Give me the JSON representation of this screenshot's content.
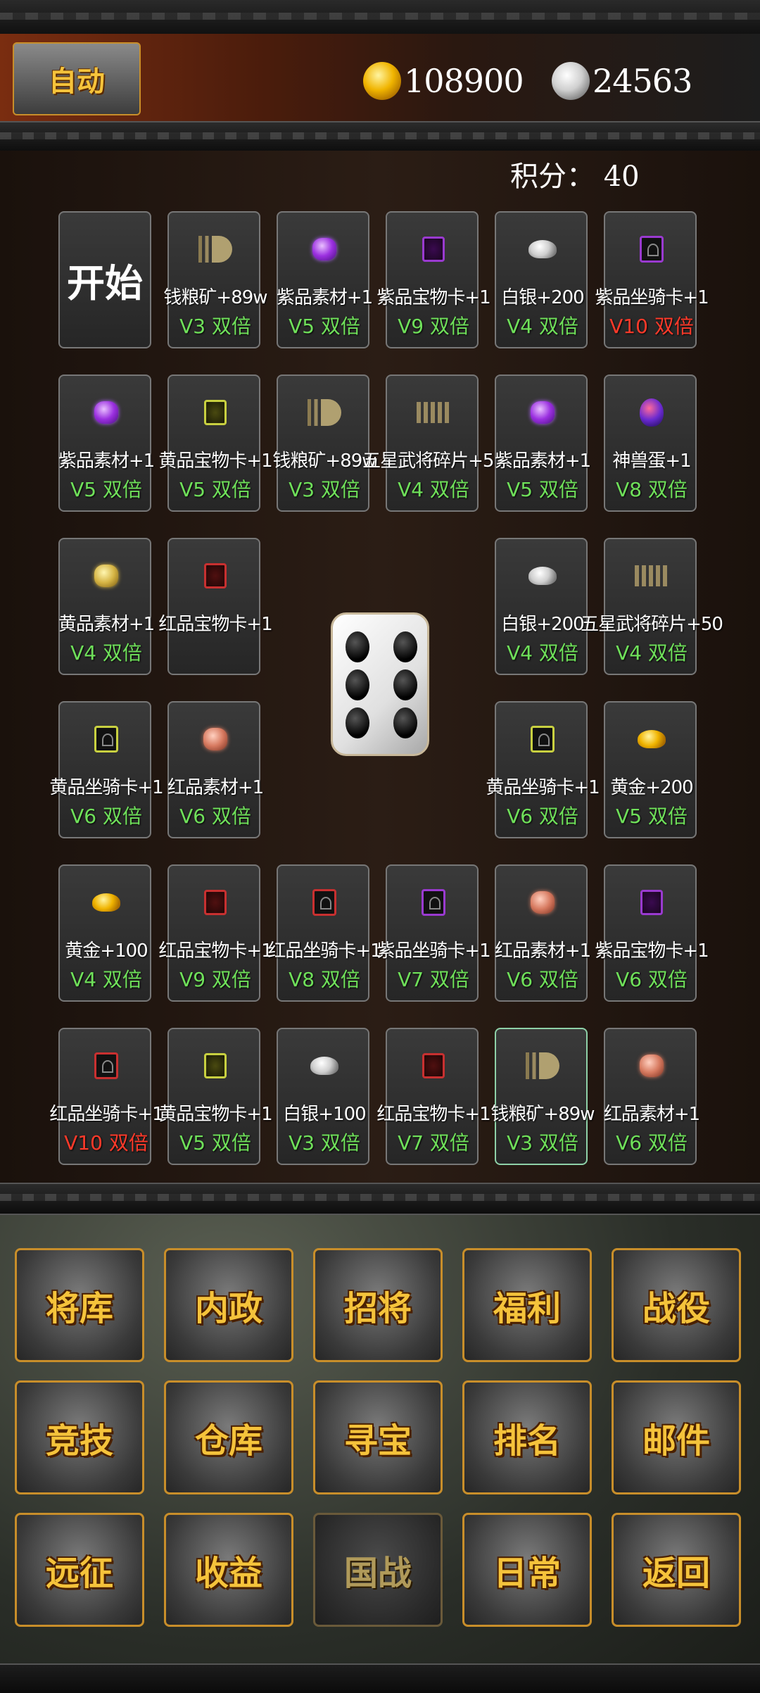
{
  "header": {
    "auto_label": "自动",
    "gold_value": "108900",
    "silver_value": "24563",
    "score_label": "积分：",
    "score_value": "40"
  },
  "board": {
    "start_label": "开始",
    "dice_value": 6,
    "cells": [
      {
        "label": "钱粮矿+89w",
        "mult": "V3 双倍",
        "icon": "grain-icon"
      },
      {
        "label": "紫品素材+1",
        "mult": "V5 双倍",
        "icon": "purple-gem-icon"
      },
      {
        "label": "紫品宝物卡+1",
        "mult": "V9 双倍",
        "icon": "purple-card-icon"
      },
      {
        "label": "白银+200",
        "mult": "V4 双倍",
        "icon": "silver-ingot-icon"
      },
      {
        "label": "紫品坐骑卡+1",
        "mult": "V10 双倍",
        "icon": "purple-mount-icon",
        "red": true
      },
      {
        "label": "紫品素材+1",
        "mult": "V5 双倍",
        "icon": "purple-gem-icon"
      },
      {
        "label": "黄品宝物卡+1",
        "mult": "V5 双倍",
        "icon": "yellow-card-icon"
      },
      {
        "label": "钱粮矿+89w",
        "mult": "V3 双倍",
        "icon": "grain-icon"
      },
      {
        "label": "五星武将碎片+50",
        "mult": "V4 双倍",
        "icon": "fragment-icon"
      },
      {
        "label": "紫品素材+1",
        "mult": "V5 双倍",
        "icon": "purple-gem-icon"
      },
      {
        "label": "神兽蛋+1",
        "mult": "V8 双倍",
        "icon": "beast-egg-icon"
      },
      {
        "label": "黄品素材+1",
        "mult": "V4 双倍",
        "icon": "yellow-gem-icon"
      },
      {
        "label": "红品宝物卡+1",
        "mult": "",
        "icon": "red-card-icon"
      },
      {
        "label": "白银+200",
        "mult": "V4 双倍",
        "icon": "silver-ingot-icon"
      },
      {
        "label": "五星武将碎片+50",
        "mult": "V4 双倍",
        "icon": "fragment-icon"
      },
      {
        "label": "黄品坐骑卡+1",
        "mult": "V6 双倍",
        "icon": "yellow-mount-icon"
      },
      {
        "label": "红品素材+1",
        "mult": "V6 双倍",
        "icon": "red-gem-icon"
      },
      {
        "label": "黄品坐骑卡+1",
        "mult": "V6 双倍",
        "icon": "yellow-mount-icon"
      },
      {
        "label": "黄金+200",
        "mult": "V5 双倍",
        "icon": "gold-ingot-icon"
      },
      {
        "label": "黄金+100",
        "mult": "V4 双倍",
        "icon": "gold-ingot-icon"
      },
      {
        "label": "红品宝物卡+1",
        "mult": "V9 双倍",
        "icon": "red-card-icon"
      },
      {
        "label": "红品坐骑卡+1",
        "mult": "V8 双倍",
        "icon": "red-mount-icon"
      },
      {
        "label": "紫品坐骑卡+1",
        "mult": "V7 双倍",
        "icon": "purple-mount-icon"
      },
      {
        "label": "红品素材+1",
        "mult": "V6 双倍",
        "icon": "red-gem-icon"
      },
      {
        "label": "紫品宝物卡+1",
        "mult": "V6 双倍",
        "icon": "purple-card-icon"
      },
      {
        "label": "红品坐骑卡+1",
        "mult": "V10 双倍",
        "icon": "red-mount-icon",
        "red": true
      },
      {
        "label": "黄品宝物卡+1",
        "mult": "V5 双倍",
        "icon": "yellow-card-icon"
      },
      {
        "label": "白银+100",
        "mult": "V3 双倍",
        "icon": "silver-ingot-icon"
      },
      {
        "label": "红品宝物卡+1",
        "mult": "V7 双倍",
        "icon": "red-card-icon"
      },
      {
        "label": "钱粮矿+89w",
        "mult": "V3 双倍",
        "icon": "grain-icon",
        "highlight": true
      },
      {
        "label": "红品素材+1",
        "mult": "V6 双倍",
        "icon": "red-gem-icon"
      }
    ]
  },
  "nav": {
    "items": [
      "将库",
      "内政",
      "招将",
      "福利",
      "战役",
      "竞技",
      "仓库",
      "寻宝",
      "排名",
      "邮件",
      "远征",
      "收益",
      "国战",
      "日常",
      "返回"
    ],
    "disabled": [
      "国战"
    ]
  },
  "colors": {
    "multiplier_green": "#6fe05a",
    "multiplier_red": "#ff3a2a",
    "button_text_gold": "#f5c33b",
    "button_border": "#c88e2a"
  }
}
